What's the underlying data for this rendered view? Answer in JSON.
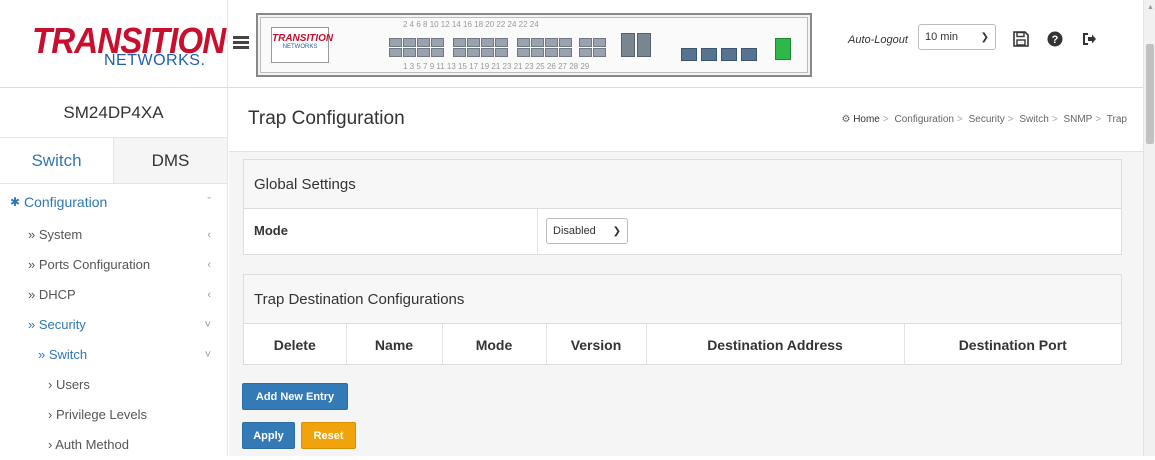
{
  "brand": {
    "logo_main": "TRANSITION",
    "logo_sub": "NETWORKS.",
    "device_logo_main": "TRANSITION",
    "device_logo_sub": "NETWORKS"
  },
  "device": {
    "top_port_numbers": "2 4 6 8 10 12 14 16 18 20 22 24 22 24",
    "bottom_port_numbers": "1 3 5 7 9 11 13 15 17 19 21 23 21 23 25 26 27 28 29",
    "active_port_color": "#2eb84a"
  },
  "header": {
    "auto_logout_label": "Auto-Logout",
    "auto_logout_value": "10 min",
    "icons": [
      "save-icon",
      "help-icon",
      "logout-icon"
    ]
  },
  "sidebar": {
    "model": "SM24DP4XA",
    "tabs": [
      {
        "label": "Switch",
        "active": true
      },
      {
        "label": "DMS",
        "active": false
      }
    ],
    "section": {
      "label": "Configuration",
      "icon": "gear-icon"
    },
    "items": [
      {
        "label": "» System",
        "chevron": "‹"
      },
      {
        "label": "» Ports Configuration",
        "chevron": "‹"
      },
      {
        "label": "» DHCP",
        "chevron": "‹"
      },
      {
        "label": "» Security",
        "chevron": "˅"
      },
      {
        "label": "» Switch",
        "chevron": "˅"
      },
      {
        "label": "› Users"
      },
      {
        "label": "› Privilege Levels"
      },
      {
        "label": "› Auth Method"
      }
    ]
  },
  "page": {
    "title": "Trap Configuration",
    "breadcrumb": [
      "Home",
      "Configuration",
      "Security",
      "Switch",
      "SNMP",
      "Trap"
    ]
  },
  "global_settings": {
    "heading": "Global Settings",
    "mode_label": "Mode",
    "mode_value": "Disabled"
  },
  "trap_destinations": {
    "heading": "Trap Destination Configurations",
    "columns": [
      "Delete",
      "Name",
      "Mode",
      "Version",
      "Destination Address",
      "Destination Port"
    ]
  },
  "buttons": {
    "add_new_entry": "Add New Entry",
    "apply": "Apply",
    "reset": "Reset"
  },
  "colors": {
    "accent": "#2f77b6",
    "brand_red": "#c8102e",
    "brand_blue": "#1f5fa8",
    "button_blue": "#337ab7",
    "button_orange": "#f0a30a"
  }
}
